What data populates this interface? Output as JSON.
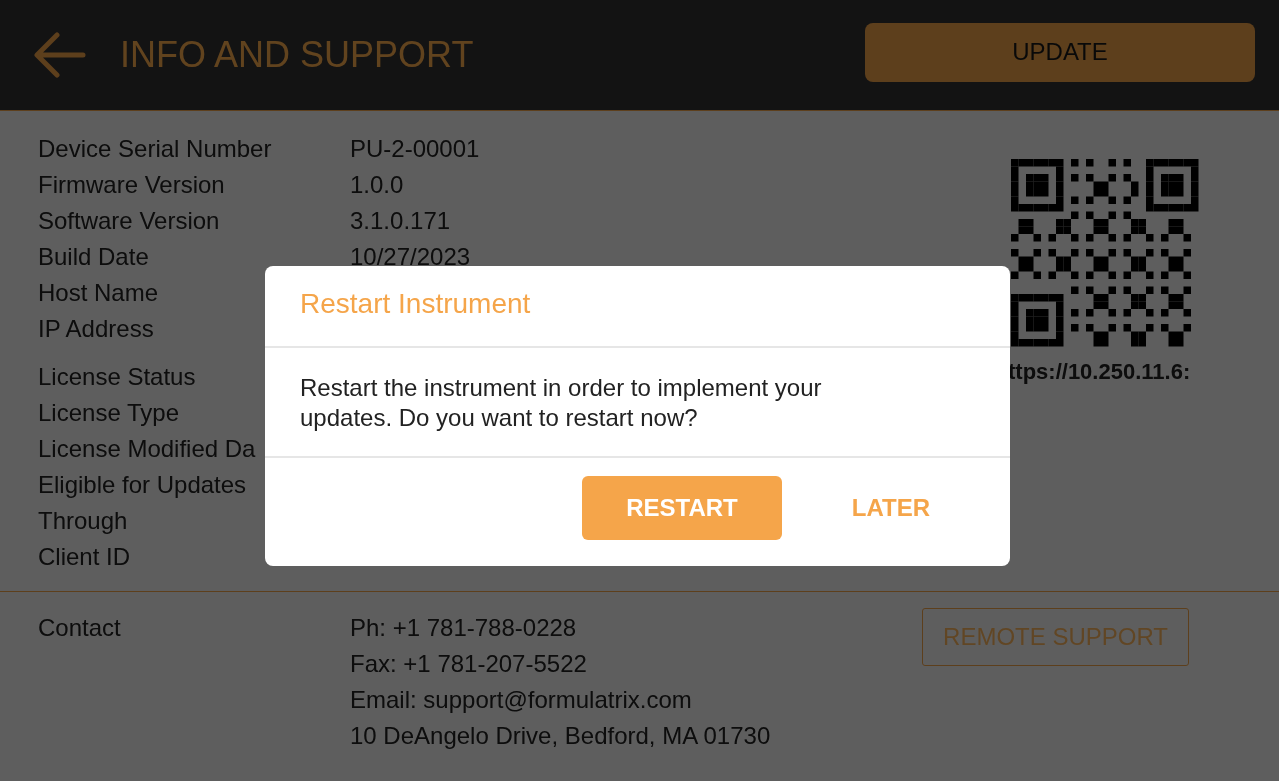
{
  "header": {
    "title": "INFO AND SUPPORT",
    "update_button": {
      "label": "UPDATE",
      "disabled": true
    }
  },
  "info_groups": [
    [
      {
        "label": "Device Serial Number",
        "value": "PU-2-00001"
      },
      {
        "label": "Firmware Version",
        "value": "1.0.0"
      },
      {
        "label": "Software Version",
        "value": "3.1.0.171"
      },
      {
        "label": "Build Date",
        "value": "10/27/2023"
      },
      {
        "label": "Host Name"
      },
      {
        "label": "IP Address"
      }
    ],
    [
      {
        "label": "License Status"
      },
      {
        "label": "License Type"
      },
      {
        "label": "License Modified Da"
      },
      {
        "label": "Eligible for Updates"
      },
      {
        "label": "Through"
      },
      {
        "label": "Client ID"
      }
    ]
  ],
  "qr": {
    "url": "ttps://10.250.11.6:"
  },
  "contact": {
    "label": "Contact",
    "lines": [
      "Ph: +1 781-788-0228",
      "Fax: +1 781-207-5522",
      "Email: support@formulatrix.com",
      "10 DeAngelo Drive, Bedford, MA 01730"
    ],
    "remote_support": "REMOTE SUPPORT"
  },
  "dialog": {
    "title": "Restart Instrument",
    "message": "Restart the instrument in order to implement your updates. Do you want to restart now?",
    "buttons": [
      {
        "label": "RESTART",
        "kind": "primary"
      },
      {
        "label": "LATER",
        "kind": "text"
      }
    ]
  }
}
